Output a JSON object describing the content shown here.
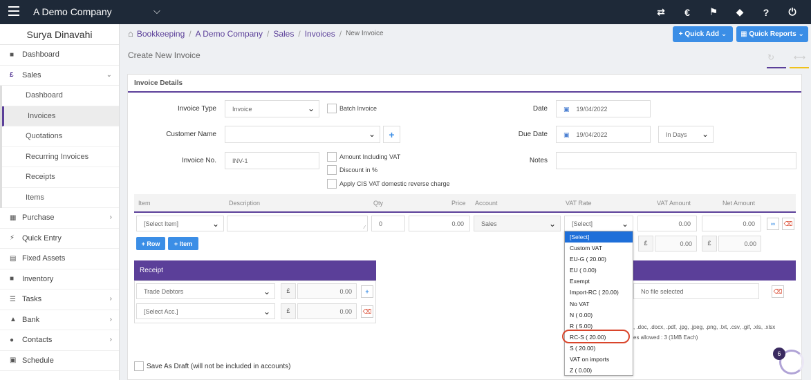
{
  "topbar": {
    "company": "A Demo Company",
    "icons": [
      "transfer-icon",
      "euro-icon",
      "megaphone-icon",
      "tag-icon",
      "help-icon",
      "power-icon"
    ]
  },
  "sidebar": {
    "user": "Surya Dinavahi",
    "items": [
      {
        "label": "Dashboard"
      },
      {
        "label": "Sales"
      },
      {
        "label": "Dashboard"
      },
      {
        "label": "Invoices"
      },
      {
        "label": "Quotations"
      },
      {
        "label": "Recurring Invoices"
      },
      {
        "label": "Receipts"
      },
      {
        "label": "Items"
      },
      {
        "label": "Purchase"
      },
      {
        "label": "Quick Entry"
      },
      {
        "label": "Fixed Assets"
      },
      {
        "label": "Inventory"
      },
      {
        "label": "Tasks"
      },
      {
        "label": "Bank"
      },
      {
        "label": "Contacts"
      },
      {
        "label": "Schedule"
      }
    ]
  },
  "breadcrumb": {
    "items": [
      "Bookkeeping",
      "A Demo Company",
      "Sales",
      "Invoices"
    ],
    "current": "New Invoice"
  },
  "buttons": {
    "quick_add": "Quick Add",
    "quick_reports": "Quick Reports",
    "add_row": "Row",
    "add_item": "Item"
  },
  "page": {
    "title": "Create New Invoice",
    "panel_title": "Invoice Details"
  },
  "form": {
    "invoice_type_label": "Invoice Type",
    "invoice_type_value": "Invoice",
    "batch_invoice_label": "Batch Invoice",
    "customer_name_label": "Customer Name",
    "invoice_no_label": "Invoice No.",
    "invoice_no_value": "INV-1",
    "amount_incl_vat_label": "Amount Including VAT",
    "discount_label": "Discount in %",
    "cis_label": "Apply CIS VAT domestic reverse charge",
    "date_label": "Date",
    "date_value": "19/04/2022",
    "due_date_label": "Due Date",
    "due_date_value": "19/04/2022",
    "due_in_value": "In Days",
    "notes_label": "Notes"
  },
  "item_table": {
    "headers": [
      "Item",
      "Description",
      "Qty",
      "Price",
      "Account",
      "VAT Rate",
      "VAT Amount",
      "Net Amount"
    ],
    "row": {
      "item": "[Select Item]",
      "qty": "0",
      "price": "0.00",
      "account": "Sales",
      "vat_rate": "[Select]",
      "vat_amount": "0.00",
      "net_amount": "0.00"
    },
    "totals": {
      "currency": "£",
      "vat_total": "0.00",
      "net_total": "0.00"
    }
  },
  "receipt": {
    "title": "Receipt",
    "rows": [
      {
        "account": "Trade Debtors",
        "currency": "£",
        "amount": "0.00"
      },
      {
        "account": "[Select Acc.]",
        "currency": "£",
        "amount": "0.00"
      }
    ]
  },
  "attachments": {
    "file_status": "No file selected",
    "types_text": ", .doc, .docx, .pdf, .jpg, .jpeg, .png, .txt, .csv, .gif, .xls, .xlsx",
    "limit_text": "es allowed : 3 (1MB Each)"
  },
  "vat_dropdown": {
    "options": [
      "[Select]",
      "Custom VAT",
      "EU-G ( 20.00)",
      "EU ( 0.00)",
      "Exempt",
      "Import-RC ( 20.00)",
      "No VAT",
      "N ( 0.00)",
      "R ( 5.00)",
      "RC-S ( 20.00)",
      "S ( 20.00)",
      "VAT on imports",
      "Z ( 0.00)"
    ],
    "selected": "[Select]",
    "highlighted": "RC-S ( 20.00)"
  },
  "draft": {
    "label": "Save As Draft (will not be included in accounts)"
  },
  "notification_count": "6",
  "colors": {
    "topbar": "#1e2938",
    "accent": "#5b3f99",
    "button": "#3b8ee6",
    "highlight_ring": "#d9452b"
  }
}
